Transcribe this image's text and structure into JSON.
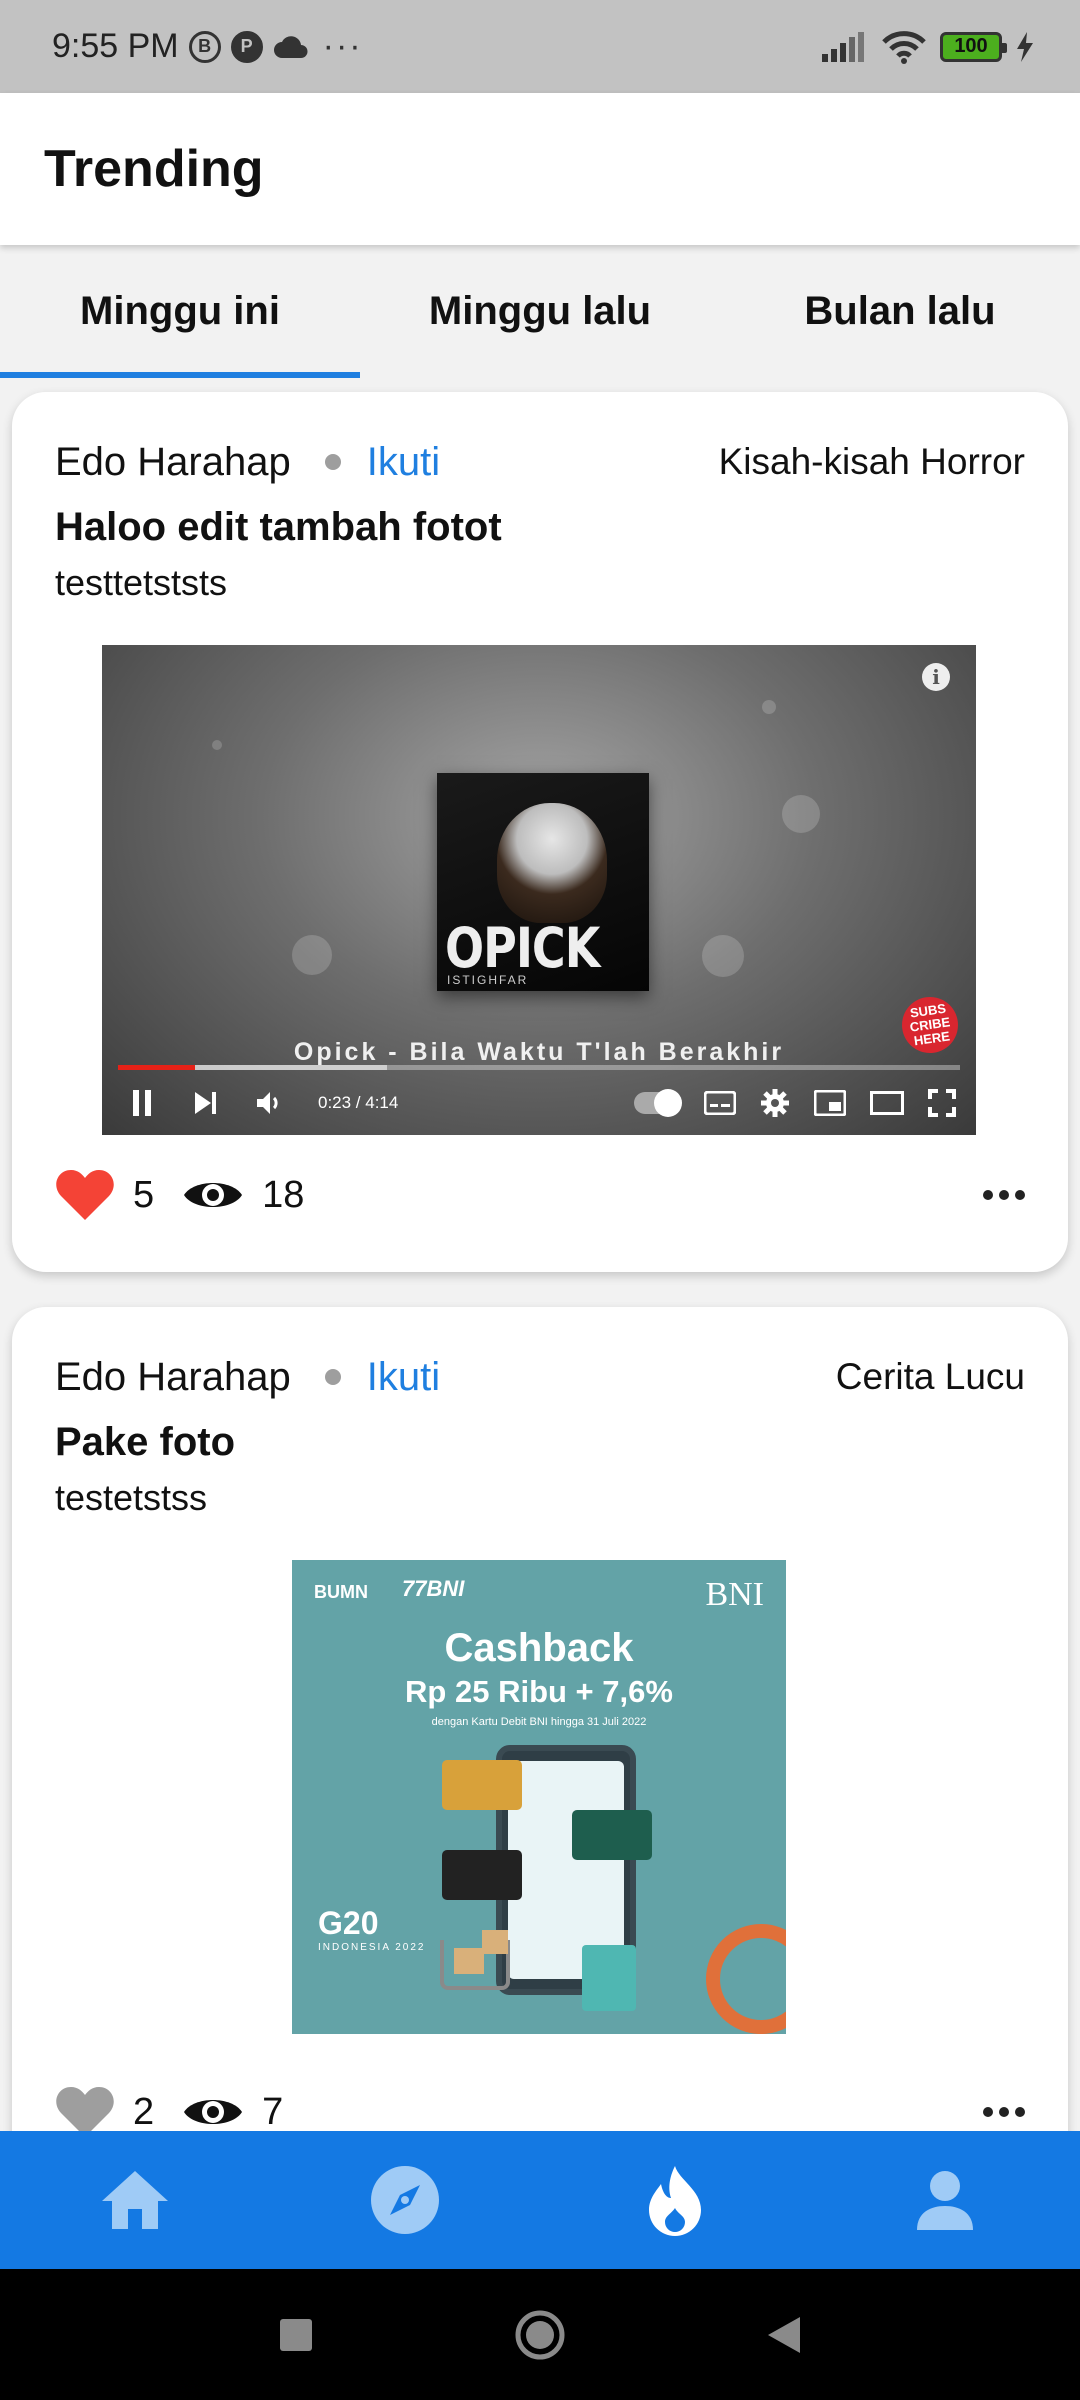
{
  "status_bar": {
    "time": "9:55 PM",
    "icons_left": [
      "b-circle-icon",
      "p-circle-icon",
      "cloud-icon"
    ],
    "more": "···",
    "battery": "100"
  },
  "app_bar": {
    "title": "Trending"
  },
  "tabs": [
    {
      "label": "Minggu ini",
      "active": true
    },
    {
      "label": "Minggu lalu",
      "active": false
    },
    {
      "label": "Bulan lalu",
      "active": false
    }
  ],
  "posts": [
    {
      "author": "Edo Harahap",
      "follow_label": "Ikuti",
      "category": "Kisah-kisah Horror",
      "title": "Haloo edit tambah fotot",
      "body": "testtetststs",
      "media": {
        "type": "video",
        "album_name": "OPICK",
        "album_subtitle": "ISTIGHFAR",
        "caption": "Opick - Bila Waktu T'lah Berakhir",
        "subscribe_badge": "SUBS CRIBE HERE",
        "timecode": "0:23 / 4:14",
        "progress_played": 0.092,
        "progress_buffered": 0.32
      },
      "likes": "5",
      "liked": true,
      "views": "18"
    },
    {
      "author": "Edo Harahap",
      "follow_label": "Ikuti",
      "category": "Cerita Lucu",
      "title": "Pake foto",
      "body": "testetstss",
      "media": {
        "type": "image",
        "logo_left": "BUMN",
        "logo_anniv": "77BNI",
        "logo_right": "BNI",
        "headline": "Cashback",
        "subheadline": "Rp 25 Ribu + 7,6%",
        "small_text": "dengan Kartu Debit BNI hingga 31 Juli 2022",
        "g20": "G20",
        "g20_sub": "INDONESIA 2022"
      },
      "likes": "2",
      "liked": false,
      "views": "7"
    }
  ],
  "bottom_nav": [
    "home-icon",
    "compass-icon",
    "fire-icon",
    "person-icon"
  ],
  "colors": {
    "accent": "#1f7fe0",
    "nav_bg": "#1479e3",
    "like_active": "#f44336",
    "like_inactive": "#9e9e9e"
  }
}
